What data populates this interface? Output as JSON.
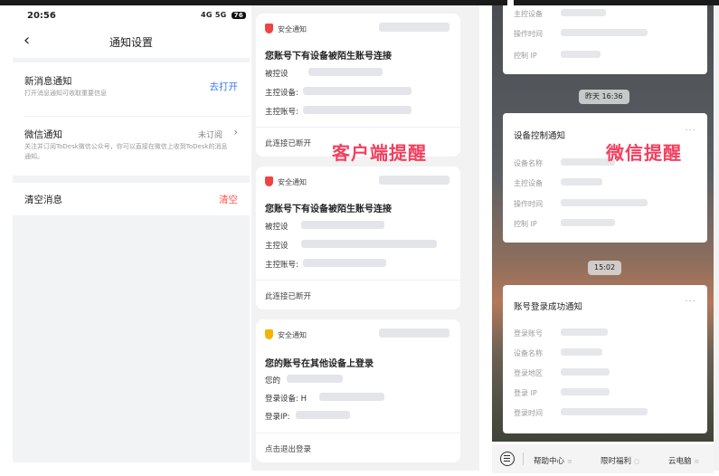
{
  "settings": {
    "status_time": "20:56",
    "status_icons": "4G 5G",
    "battery": "76",
    "nav_title": "通知设置",
    "new_msg": {
      "title": "新消息通知",
      "desc": "打开消息通知可收取重要信息",
      "action": "去打开"
    },
    "wechat": {
      "title": "微信通知",
      "desc": "关注并订阅ToDesk微信公众号，你可以直接在微信上收到ToDesk的消息通知。",
      "action": "未订阅"
    },
    "clear": {
      "title": "清空消息",
      "action": "清空"
    }
  },
  "client": {
    "overlay_label": "客户端提醒",
    "cards": [
      {
        "head": "安全通知",
        "title": "您账号下有设备被陌生账号连接",
        "lines": [
          "被控设",
          "主控设备:",
          "主控账号:"
        ],
        "foot": "此连接已断开"
      },
      {
        "head": "安全通知",
        "title": "您账号下有设备被陌生账号连接",
        "lines": [
          "被控设",
          "主控设",
          "主控账号:"
        ],
        "foot": "此连接已断开"
      },
      {
        "head": "安全通知",
        "title": "您的账号在其他设备上登录",
        "lines": [
          "您的",
          "登录设备: H",
          "登录IP:"
        ],
        "foot": "点击退出登录"
      }
    ]
  },
  "wechat_panel": {
    "overlay_label": "微信提醒",
    "top_fields": [
      "主控设备",
      "操作时间",
      "控制 IP"
    ],
    "time_pill_1": "昨天 16:36",
    "card1": {
      "title": "设备控制通知",
      "fields": [
        "设备名称",
        "主控设备",
        "操作时间",
        "控制 IP"
      ]
    },
    "time_pill_2": "15:02",
    "card2": {
      "title": "账号登录成功通知",
      "fields": [
        "登录账号",
        "设备名称",
        "登录地区",
        "登录 IP",
        "登录时间"
      ]
    },
    "bottom": {
      "help": "帮助中心",
      "welfare": "限时福利",
      "cloud": "云电脑"
    }
  },
  "colors": {
    "accent_blue": "#3a7bf5",
    "danger_red": "#ff5a4e",
    "overlay_red": "#f43f5e",
    "warn_yellow": "#f5b400"
  }
}
